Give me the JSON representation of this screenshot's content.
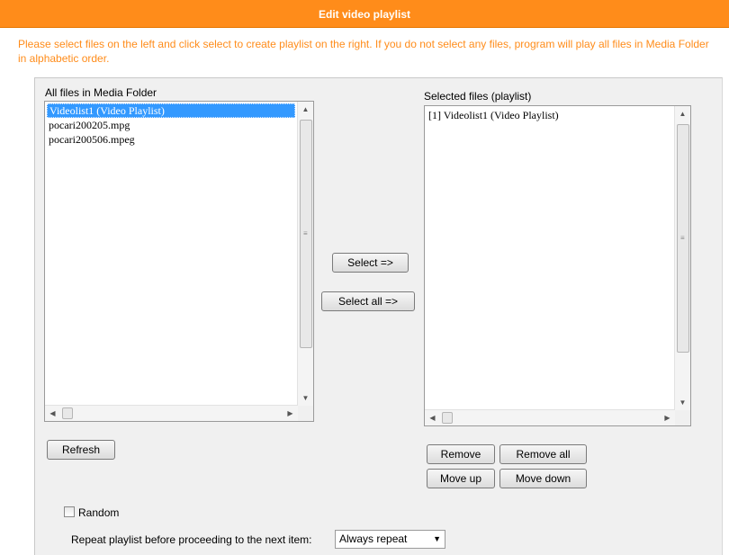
{
  "window": {
    "title": "Edit video playlist"
  },
  "instructions": "Please select files on the left and click select to create playlist on the right. If you do not select any files, program will play all files in Media Folder in alphabetic order.",
  "left_list": {
    "label": "All files in Media Folder",
    "items": [
      "Videolist1 (Video Playlist)",
      "pocari200205.mpg",
      "pocari200506.mpeg"
    ],
    "selected_index": 0
  },
  "right_list": {
    "label": "Selected files (playlist)",
    "items": [
      "[1] Videolist1 (Video Playlist)"
    ]
  },
  "buttons": {
    "select": "Select =>",
    "select_all": "Select all =>",
    "refresh": "Refresh",
    "remove": "Remove",
    "remove_all": "Remove all",
    "move_up": "Move up",
    "move_down": "Move down"
  },
  "random": {
    "label": "Random",
    "checked": false
  },
  "repeat": {
    "label": "Repeat playlist before proceeding to the next item:",
    "value": "Always repeat"
  },
  "colors": {
    "accent": "#ff8c1a",
    "selection": "#3399ff",
    "panel": "#f0f0f0"
  }
}
